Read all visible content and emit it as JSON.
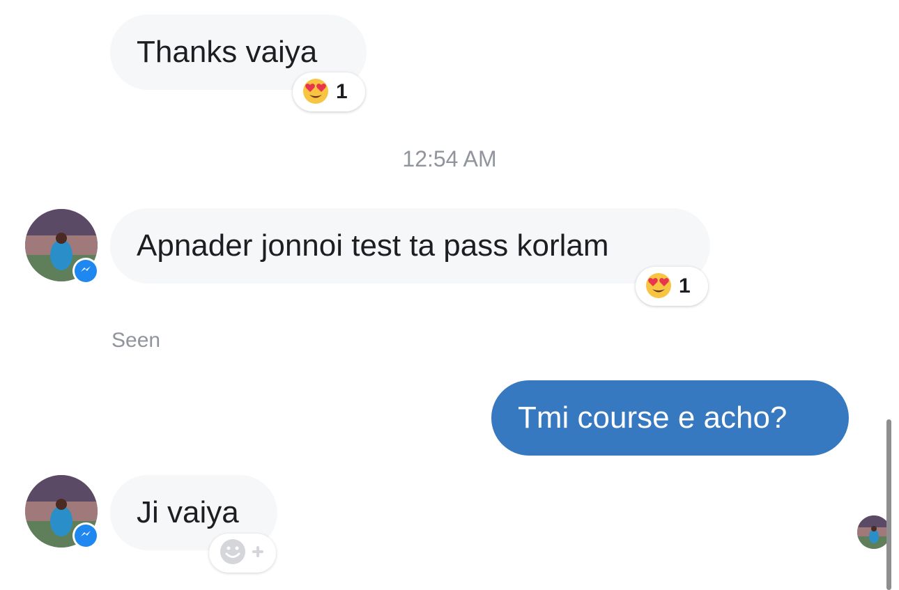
{
  "conversation": {
    "timestamp": "12:54 AM",
    "seen_label": "Seen",
    "messages": [
      {
        "text": "Thanks vaiya",
        "direction": "incoming",
        "reaction": {
          "emoji": "heart-eyes-emoji",
          "count": "1"
        }
      },
      {
        "text": "Apnader jonnoi test ta pass korlam",
        "direction": "incoming",
        "reaction": {
          "emoji": "heart-eyes-emoji",
          "count": "1"
        }
      },
      {
        "text": "Tmi course e acho?",
        "direction": "outgoing"
      },
      {
        "text": "Ji vaiya",
        "direction": "incoming"
      }
    ]
  },
  "colors": {
    "outgoing_bubble": "#3779c0",
    "incoming_bubble": "#f6f7f9",
    "messenger_badge": "#1e88f0",
    "meta_text": "#90949c"
  },
  "icons": {
    "reaction": "heart-eyes-emoji",
    "add_reaction": "smiley-plus-icon",
    "badge": "messenger-bolt-icon"
  }
}
